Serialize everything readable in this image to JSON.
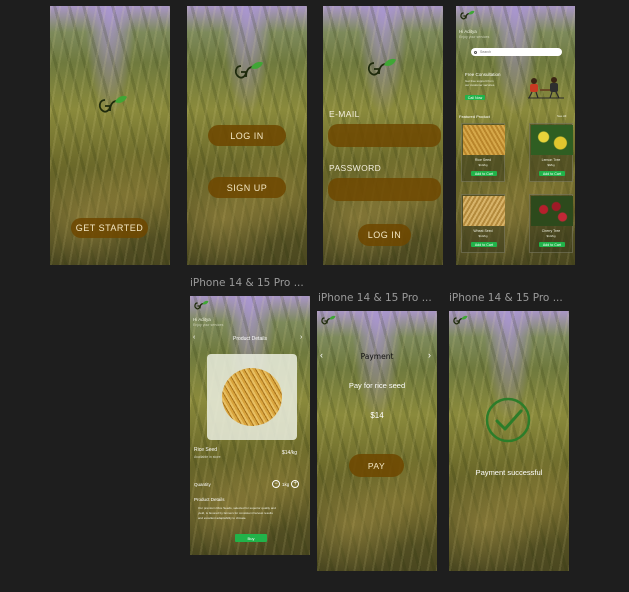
{
  "screens": {
    "s1": {
      "get_started": "GET STARTED"
    },
    "s2": {
      "login": "LOG IN",
      "signup": "SIGN UP"
    },
    "s3": {
      "email_label": "E-MAIL",
      "password_label": "PASSWORD",
      "login": "LOG IN"
    },
    "s4": {
      "greeting": "Hi Aditya",
      "sub": "Enjoy your services",
      "search_placeholder": "Search",
      "consult_title": "Free Consultation",
      "consult_sub1": "Get free support from",
      "consult_sub2": "our customer services",
      "call_btn": "Call Now",
      "featured": "Featured Product",
      "see_all": "See All",
      "products": [
        {
          "name": "Rice Seed",
          "price": "$14/kg",
          "btn": "Add to Cart",
          "color": "#c8962f"
        },
        {
          "name": "Lemon Tree",
          "price": "$9/kg",
          "btn": "Add to Cart",
          "color": "#d8c23a"
        },
        {
          "name": "Wheat Seed",
          "price": "$14/kg",
          "btn": "Add to Cart",
          "color": "#c9a35a"
        },
        {
          "name": "Cherry Tree",
          "price": "$14/kg",
          "btn": "Add to Cart",
          "color": "#a3202c"
        }
      ]
    },
    "s5": {
      "frame_label": "iPhone 14 & 15 Pro ...",
      "greeting": "Hi Aditya",
      "sub": "Enjoy your services",
      "header": "Product Details",
      "product_name": "Rice Seed",
      "product_sub": "Available in store",
      "price": "$14/kg",
      "quantity_label": "Quantity",
      "quantity_value": "1kg",
      "details_title": "Product Details",
      "details_text1": "Our premium Rice Seeds, selected for superior quality and",
      "details_text2": "yield, is favored by farmers for consistent harvest results",
      "details_text3": "and excellent adaptability to climate.",
      "buy_btn": "Buy"
    },
    "s6": {
      "frame_label": "iPhone 14 & 15 Pro ...",
      "title": "Payment",
      "pay_for": "Pay for rice seed",
      "amount": "$14",
      "pay_btn": "PAY"
    },
    "s7": {
      "frame_label": "iPhone 14 & 15 Pro ...",
      "message": "Payment successful"
    }
  }
}
